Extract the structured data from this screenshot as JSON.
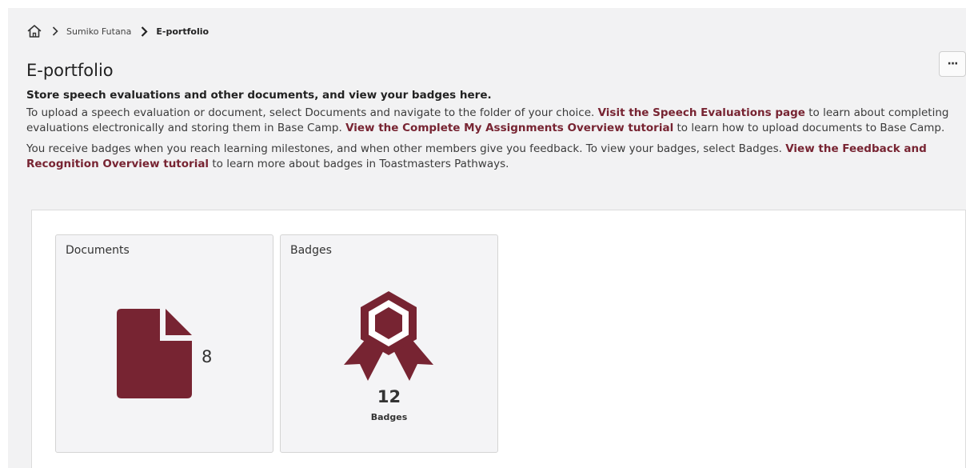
{
  "breadcrumb": {
    "home_icon": "home-icon",
    "items": [
      "Sumiko Futana",
      "E-portfolio"
    ]
  },
  "header": {
    "title": "E-portfolio",
    "more_label": "···"
  },
  "intro": {
    "lead": "Store speech evaluations and other documents, and view your badges here.",
    "p1_text1": "To upload a speech evaluation or document, select Documents and navigate to the folder of your choice. ",
    "p1_link1": "Visit the Speech Evaluations page",
    "p1_text2": " to learn about completing evaluations electronically and storing them in Base Camp. ",
    "p1_link2": "View the Complete My Assignments Overview tutorial",
    "p1_text3": " to learn how to upload documents to Base Camp.",
    "p2_text1": "You receive badges when you reach learning milestones, and when other members give you feedback. To view your badges, select Badges. ",
    "p2_link1": "View the Feedback and Recognition Overview tutorial",
    "p2_text2": " to learn more about badges in Toastmasters Pathways."
  },
  "tiles": {
    "documents": {
      "label": "Documents",
      "count": "8",
      "icon": "document-icon"
    },
    "badges": {
      "label": "Badges",
      "count": "12",
      "caption": "Badges",
      "icon": "award-ribbon-icon"
    }
  },
  "colors": {
    "brand": "#772432",
    "background": "#f2f2f3"
  }
}
